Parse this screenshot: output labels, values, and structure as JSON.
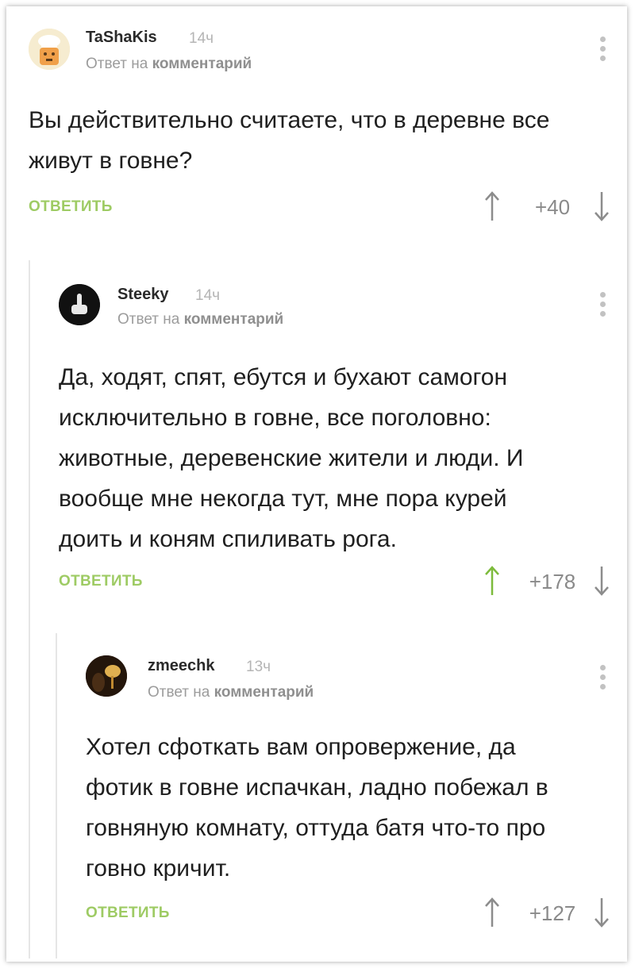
{
  "comments": [
    {
      "author": "TaShaKis",
      "time": "14ч",
      "reply_prefix": "Ответ на",
      "reply_target": "комментарий",
      "text_lines": [
        "Вы действительно считаете, что в деревне все",
        "живут в говне?"
      ],
      "reply_label": "ОТВЕТИТЬ",
      "rating": "+40",
      "upvoted": false
    },
    {
      "author": "Steeky",
      "time": "14ч",
      "reply_prefix": "Ответ на",
      "reply_target": "комментарий",
      "text_lines": [
        "Да, ходят, спят, ебутся и бухают самогон",
        "исключительно в говне, все поголовно:",
        "животные, деревенские жители и люди. И",
        "вообще мне некогда тут, мне пора курей",
        "доить и коням спиливать рога."
      ],
      "reply_label": "ОТВЕТИТЬ",
      "rating": "+178",
      "upvoted": true
    },
    {
      "author": "zmeechk",
      "time": "13ч",
      "reply_prefix": "Ответ на",
      "reply_target": "комментарий",
      "text_lines": [
        "Хотел сфоткать вам опровержение, да",
        "фотик в говне испачкан, ладно побежал в",
        "говняную комнату, оттуда батя что-то про",
        "говно кричит."
      ],
      "reply_label": "ОТВЕТИТЬ",
      "rating": "+127",
      "upvoted": false
    }
  ],
  "icons": {
    "upvote": "arrow-up-icon",
    "downvote": "arrow-down-icon",
    "menu": "vertical-dots-icon"
  },
  "colors": {
    "accent_green": "#9ecb64",
    "upvoted_arrow": "#7dbb3c",
    "neutral_arrow": "#8c8c8c"
  }
}
